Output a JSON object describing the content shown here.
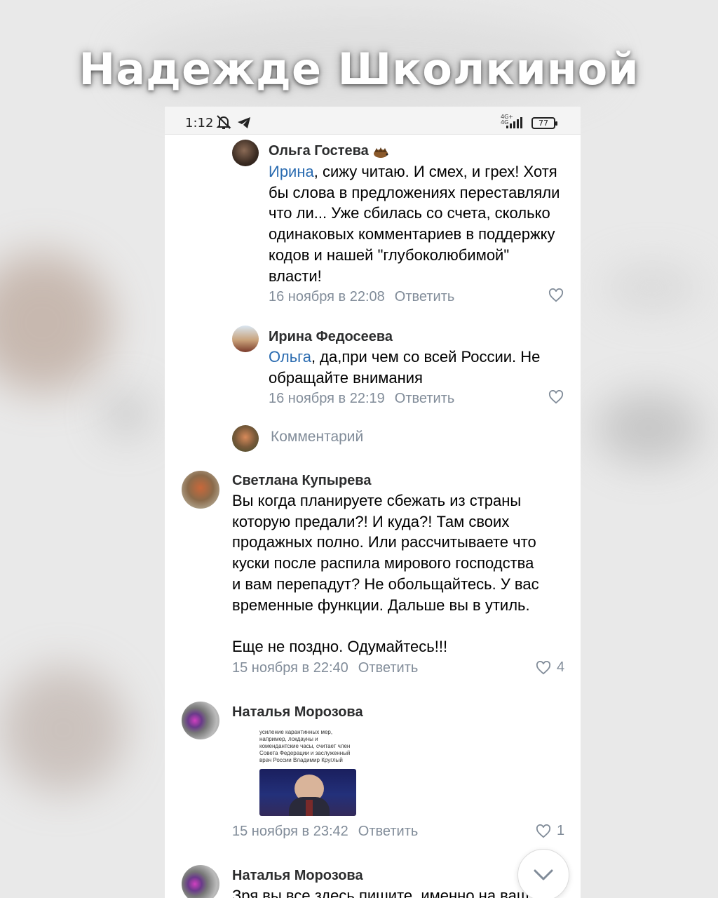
{
  "overlay": {
    "title": "Надежде Школкиной"
  },
  "status_bar": {
    "time": "1:12",
    "network": "4G+",
    "network2": "4G",
    "battery": "77"
  },
  "comments": [
    {
      "author": "Ольга Гостева",
      "mention": "Ирина",
      "text": ", сижу читаю. И смех, и грех! Хотя бы слова в предложениях переставляли что ли... Уже сбилась со счета, сколько одинаковых комментариев в поддержку кодов и нашей \"глубоколюбимой\" власти!",
      "date": "16 ноября в 22:08",
      "reply": "Ответить",
      "likes": ""
    },
    {
      "author": "Ирина Федосеева",
      "mention": "Ольга",
      "text": ", да,при чем со всей России. Не обращайте внимания",
      "date": "16 ноября в 22:19",
      "reply": "Ответить",
      "likes": ""
    },
    {
      "author": "Светлана Купырева",
      "text_lines": [
        "Вы когда планируете сбежать из страны",
        "которую предали?! И куда?! Там своих",
        "продажных полно. Или рассчитываете что",
        "куски после распила мирового господства",
        "и вам перепадут? Не обольщайтесь. У вас",
        "временные функции. Дальше вы в утиль.",
        "",
        "Еще не поздно. Одумайтесь!!!"
      ],
      "date": "15 ноября в 22:40",
      "reply": "Ответить",
      "likes": "4"
    },
    {
      "author": "Наталья Морозова",
      "image_text": "усиление карантинных мер, например, локдауны и комендантские часы, считает член Совета Федерации и заслуженный врач России Владимир Круглый",
      "date": "15 ноября в 23:42",
      "reply": "Ответить",
      "likes": "1"
    },
    {
      "author": "Наталья Морозова",
      "text": "Зря вы все здесь пишите, именно на ваш"
    }
  ],
  "composer": {
    "placeholder": "Комментарий"
  },
  "icons": {
    "heart": "heart-icon",
    "scroll": "chevron-down-icon"
  },
  "colors": {
    "link": "#2a6bb0",
    "meta": "#818c99",
    "text": "#000000"
  }
}
